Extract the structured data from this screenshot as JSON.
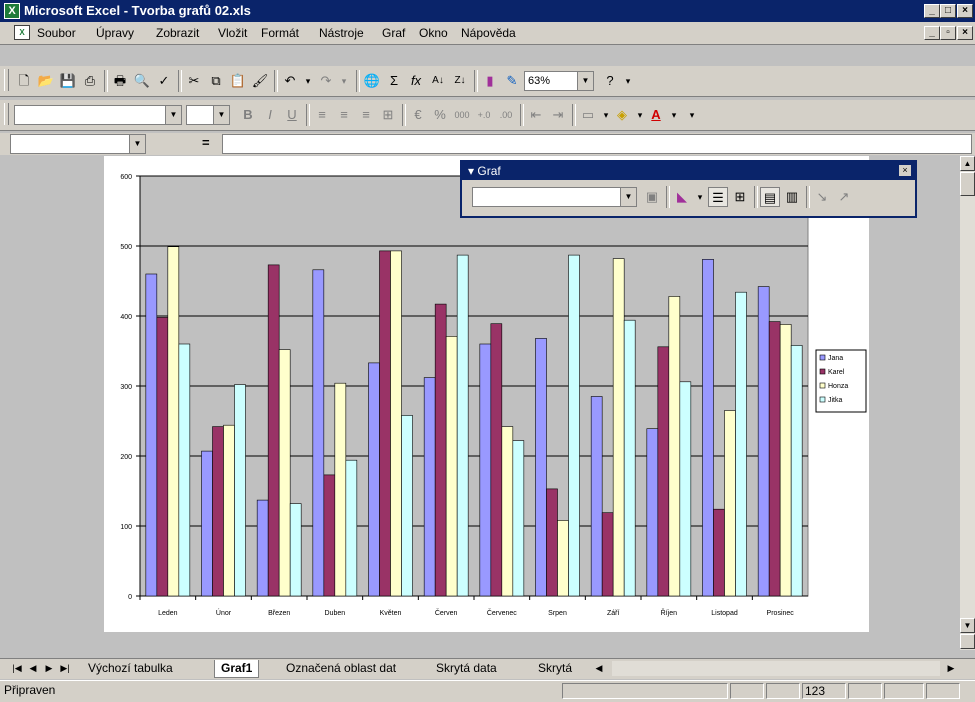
{
  "window": {
    "title": "Microsoft Excel - Tvorba grafů 02.xls"
  },
  "menu": [
    "Soubor",
    "Úpravy",
    "Zobrazit",
    "Vložit",
    "Formát",
    "Nástroje",
    "Graf",
    "Okno",
    "Nápověda"
  ],
  "toolbar": {
    "zoom": "63%"
  },
  "graf_toolbar": {
    "title": "Graf"
  },
  "sheet_tabs": [
    "Výchozí tabulka",
    "Graf1",
    "Označená oblast dat",
    "Skrytá data",
    "Skrytá"
  ],
  "active_tab": "Graf1",
  "status": {
    "text": "Připraven",
    "num": "123"
  },
  "colors": {
    "Jana": "#9999ff",
    "Karel": "#993366",
    "Honza": "#ffffcc",
    "Jitka": "#ccffff"
  },
  "chart_data": {
    "type": "bar",
    "categories": [
      "Leden",
      "Únor",
      "Březen",
      "Duben",
      "Květen",
      "Červen",
      "Červenec",
      "Srpen",
      "Září",
      "Říjen",
      "Listopad",
      "Prosinec"
    ],
    "series": [
      {
        "name": "Jana",
        "values": [
          460,
          207,
          137,
          466,
          333,
          312,
          360,
          368,
          285,
          239,
          481,
          442
        ]
      },
      {
        "name": "Karel",
        "values": [
          398,
          242,
          473,
          173,
          493,
          417,
          389,
          153,
          119,
          356,
          124,
          392
        ]
      },
      {
        "name": "Honza",
        "values": [
          499,
          244,
          352,
          304,
          493,
          371,
          242,
          108,
          482,
          428,
          265,
          388
        ]
      },
      {
        "name": "Jitka",
        "values": [
          360,
          302,
          132,
          194,
          258,
          487,
          222,
          487,
          394,
          306,
          434,
          358
        ]
      }
    ],
    "ylim": [
      0,
      600
    ],
    "yticks": [
      "0",
      "100",
      "200",
      "300",
      "400",
      "500",
      "600"
    ],
    "grid": true,
    "legend": "right"
  }
}
